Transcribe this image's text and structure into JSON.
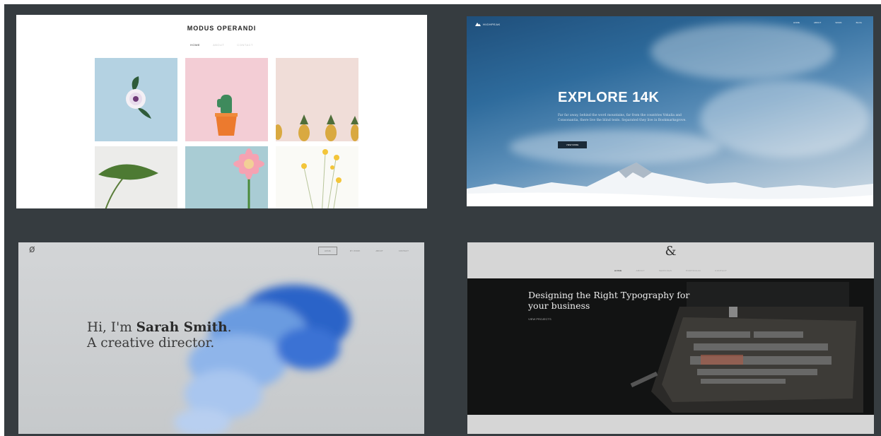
{
  "panels": {
    "modus": {
      "title": "MODUS OPERANDI",
      "nav": [
        "HOME",
        "ABOUT",
        "CONTACT"
      ],
      "tiles": [
        "flower-tile",
        "cactus-tile",
        "pineapple-tile",
        "monstera-tile",
        "gerbera-tile",
        "yellow-flowers-tile"
      ]
    },
    "highpeak": {
      "logo": "HIGHPEAK",
      "nav": [
        "HOME",
        "ABOUT",
        "WORK",
        "BLOG"
      ],
      "hero_title": "EXPLORE 14K",
      "hero_text": "Far far away, behind the word mountains, far from the countries Vokalia and Consonantia, there live the blind texts. Separated they live in Bookmarksgrove.",
      "cta_label": "VIEW MORE"
    },
    "sarah": {
      "logo_glyph": "ø",
      "nav": [
        "HOME",
        "MY WORK",
        "ABOUT",
        "CONTACT"
      ],
      "headline_pre": "Hi, I'm ",
      "headline_name": "Sarah Smith",
      "headline_post": ". A creative director."
    },
    "typography": {
      "logo_glyph": "&",
      "nav": [
        "HOME",
        "ABOUT",
        "SERVICES",
        "PORTFOLIO",
        "CONTACT"
      ],
      "heading": "Designing the Right Typography for your business",
      "link": "VIEW PROJECTS"
    }
  },
  "colors": {
    "background": "#363c40",
    "modus_bg": "#ffffff",
    "sky_dark": "#1f4f7b",
    "sarah_bg": "#d3d5d7",
    "ink_blue": "#2f6fd0",
    "typo_dark": "#121313"
  }
}
